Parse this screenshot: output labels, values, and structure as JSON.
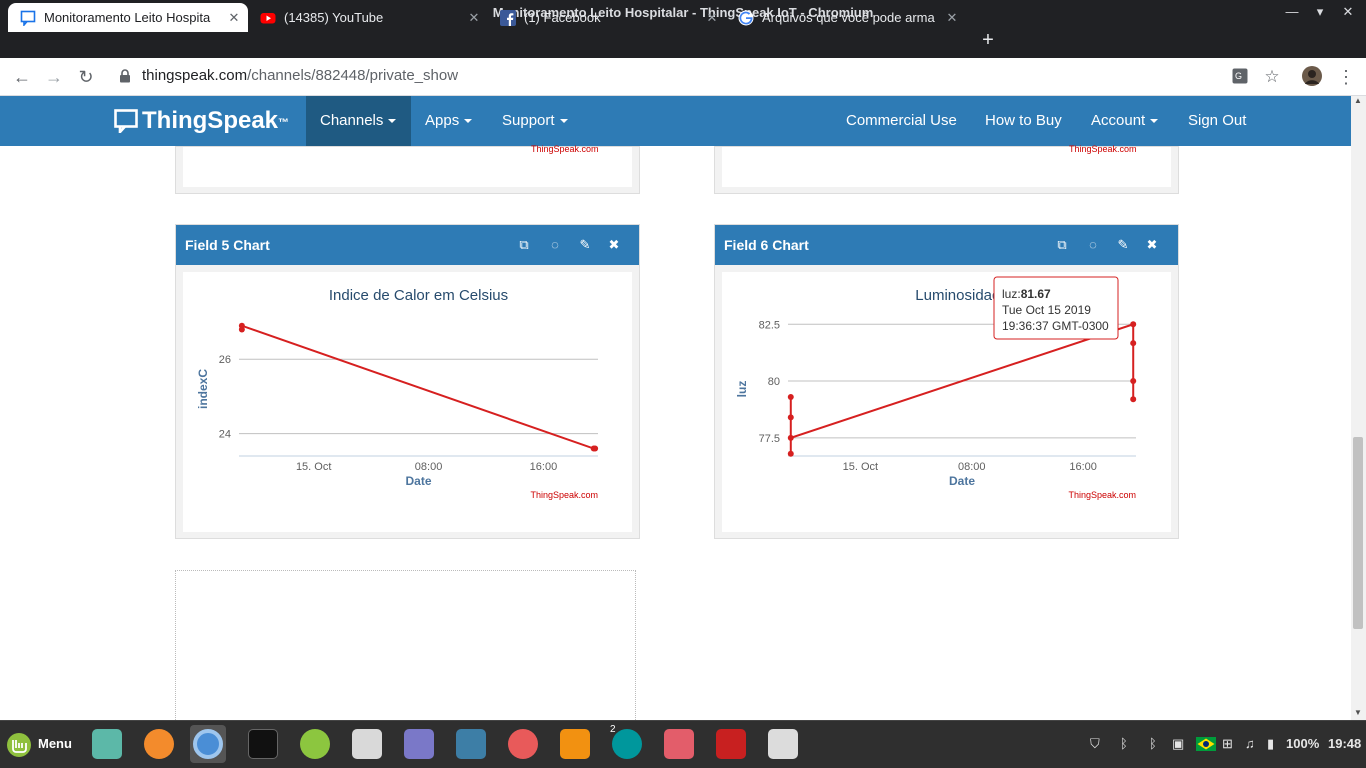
{
  "window": {
    "title": "Monitoramento Leito Hospitalar - ThingSpeak IoT - Chromium"
  },
  "tabs": [
    {
      "title": "Monitoramento Leito Hospita",
      "icon": "chat-bubble-icon"
    },
    {
      "title": "(14385) YouTube",
      "icon": "youtube-icon"
    },
    {
      "title": "(1) Facebook",
      "icon": "facebook-icon"
    },
    {
      "title": "Arquivos que você pode arma",
      "icon": "google-icon"
    }
  ],
  "addressbar": {
    "host": "thingspeak.com",
    "path": "/channels/882448/private_show"
  },
  "nav": {
    "logo": "ThingSpeak",
    "logo_tm": "™",
    "channels": "Channels",
    "apps": "Apps",
    "support": "Support",
    "commercial": "Commercial Use",
    "howtobuy": "How to Buy",
    "account": "Account",
    "signout": "Sign Out"
  },
  "credit": "ThingSpeak.com",
  "panels": {
    "field5": {
      "header": "Field 5 Chart"
    },
    "field6": {
      "header": "Field 6 Chart"
    }
  },
  "chart_data": [
    {
      "type": "line",
      "title": "Indice de Calor em Celsius",
      "xlabel": "Date",
      "ylabel": "indexC",
      "x_ticks": [
        "15. Oct",
        "08:00",
        "16:00"
      ],
      "y_ticks": [
        24,
        26
      ],
      "ylim": [
        23.4,
        27.0
      ],
      "color": "#d62020",
      "series": [
        {
          "x": [
            "Oct 14 19:00",
            "Oct 14 19:00",
            "Oct 15 19:30",
            "Oct 15 19:36"
          ],
          "values": [
            26.8,
            26.9,
            23.6,
            23.6
          ]
        }
      ]
    },
    {
      "type": "line",
      "title": "Luminosidade",
      "xlabel": "Date",
      "ylabel": "luz",
      "x_ticks": [
        "15. Oct",
        "08:00",
        "16:00"
      ],
      "y_ticks": [
        77.5,
        80,
        82.5
      ],
      "ylim": [
        76.7,
        82.6
      ],
      "color": "#d62020",
      "series": [
        {
          "x": [
            "Oct 14 19:00",
            "Oct 14 19:00",
            "Oct 14 19:00",
            "Oct 14 19:00",
            "Oct 15 19:36",
            "Oct 15 19:36",
            "Oct 15 19:36",
            "Oct 15 19:36"
          ],
          "values": [
            76.8,
            79.3,
            78.4,
            77.5,
            82.5,
            79.2,
            81.67,
            80.0
          ]
        }
      ],
      "tooltip": {
        "label": "luz:",
        "value": "81.67",
        "date": "Tue Oct 15 2019",
        "time": "19:36:37 GMT-0300"
      }
    }
  ],
  "taskbar": {
    "menu": "Menu",
    "badge": "2",
    "battery": "100%",
    "clock": "19:48"
  }
}
